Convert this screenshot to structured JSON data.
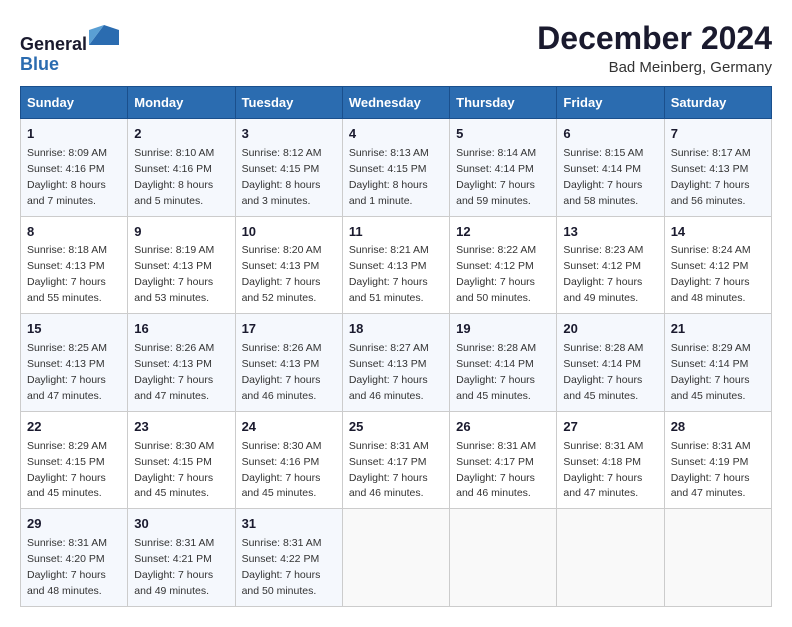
{
  "header": {
    "logo_line1": "General",
    "logo_line2": "Blue",
    "month": "December 2024",
    "location": "Bad Meinberg, Germany"
  },
  "days_of_week": [
    "Sunday",
    "Monday",
    "Tuesday",
    "Wednesday",
    "Thursday",
    "Friday",
    "Saturday"
  ],
  "weeks": [
    [
      {
        "day": "1",
        "sunrise": "8:09 AM",
        "sunset": "4:16 PM",
        "daylight": "8 hours and 7 minutes."
      },
      {
        "day": "2",
        "sunrise": "8:10 AM",
        "sunset": "4:16 PM",
        "daylight": "8 hours and 5 minutes."
      },
      {
        "day": "3",
        "sunrise": "8:12 AM",
        "sunset": "4:15 PM",
        "daylight": "8 hours and 3 minutes."
      },
      {
        "day": "4",
        "sunrise": "8:13 AM",
        "sunset": "4:15 PM",
        "daylight": "8 hours and 1 minute."
      },
      {
        "day": "5",
        "sunrise": "8:14 AM",
        "sunset": "4:14 PM",
        "daylight": "7 hours and 59 minutes."
      },
      {
        "day": "6",
        "sunrise": "8:15 AM",
        "sunset": "4:14 PM",
        "daylight": "7 hours and 58 minutes."
      },
      {
        "day": "7",
        "sunrise": "8:17 AM",
        "sunset": "4:13 PM",
        "daylight": "7 hours and 56 minutes."
      }
    ],
    [
      {
        "day": "8",
        "sunrise": "8:18 AM",
        "sunset": "4:13 PM",
        "daylight": "7 hours and 55 minutes."
      },
      {
        "day": "9",
        "sunrise": "8:19 AM",
        "sunset": "4:13 PM",
        "daylight": "7 hours and 53 minutes."
      },
      {
        "day": "10",
        "sunrise": "8:20 AM",
        "sunset": "4:13 PM",
        "daylight": "7 hours and 52 minutes."
      },
      {
        "day": "11",
        "sunrise": "8:21 AM",
        "sunset": "4:13 PM",
        "daylight": "7 hours and 51 minutes."
      },
      {
        "day": "12",
        "sunrise": "8:22 AM",
        "sunset": "4:12 PM",
        "daylight": "7 hours and 50 minutes."
      },
      {
        "day": "13",
        "sunrise": "8:23 AM",
        "sunset": "4:12 PM",
        "daylight": "7 hours and 49 minutes."
      },
      {
        "day": "14",
        "sunrise": "8:24 AM",
        "sunset": "4:12 PM",
        "daylight": "7 hours and 48 minutes."
      }
    ],
    [
      {
        "day": "15",
        "sunrise": "8:25 AM",
        "sunset": "4:13 PM",
        "daylight": "7 hours and 47 minutes."
      },
      {
        "day": "16",
        "sunrise": "8:26 AM",
        "sunset": "4:13 PM",
        "daylight": "7 hours and 47 minutes."
      },
      {
        "day": "17",
        "sunrise": "8:26 AM",
        "sunset": "4:13 PM",
        "daylight": "7 hours and 46 minutes."
      },
      {
        "day": "18",
        "sunrise": "8:27 AM",
        "sunset": "4:13 PM",
        "daylight": "7 hours and 46 minutes."
      },
      {
        "day": "19",
        "sunrise": "8:28 AM",
        "sunset": "4:14 PM",
        "daylight": "7 hours and 45 minutes."
      },
      {
        "day": "20",
        "sunrise": "8:28 AM",
        "sunset": "4:14 PM",
        "daylight": "7 hours and 45 minutes."
      },
      {
        "day": "21",
        "sunrise": "8:29 AM",
        "sunset": "4:14 PM",
        "daylight": "7 hours and 45 minutes."
      }
    ],
    [
      {
        "day": "22",
        "sunrise": "8:29 AM",
        "sunset": "4:15 PM",
        "daylight": "7 hours and 45 minutes."
      },
      {
        "day": "23",
        "sunrise": "8:30 AM",
        "sunset": "4:15 PM",
        "daylight": "7 hours and 45 minutes."
      },
      {
        "day": "24",
        "sunrise": "8:30 AM",
        "sunset": "4:16 PM",
        "daylight": "7 hours and 45 minutes."
      },
      {
        "day": "25",
        "sunrise": "8:31 AM",
        "sunset": "4:17 PM",
        "daylight": "7 hours and 46 minutes."
      },
      {
        "day": "26",
        "sunrise": "8:31 AM",
        "sunset": "4:17 PM",
        "daylight": "7 hours and 46 minutes."
      },
      {
        "day": "27",
        "sunrise": "8:31 AM",
        "sunset": "4:18 PM",
        "daylight": "7 hours and 47 minutes."
      },
      {
        "day": "28",
        "sunrise": "8:31 AM",
        "sunset": "4:19 PM",
        "daylight": "7 hours and 47 minutes."
      }
    ],
    [
      {
        "day": "29",
        "sunrise": "8:31 AM",
        "sunset": "4:20 PM",
        "daylight": "7 hours and 48 minutes."
      },
      {
        "day": "30",
        "sunrise": "8:31 AM",
        "sunset": "4:21 PM",
        "daylight": "7 hours and 49 minutes."
      },
      {
        "day": "31",
        "sunrise": "8:31 AM",
        "sunset": "4:22 PM",
        "daylight": "7 hours and 50 minutes."
      },
      null,
      null,
      null,
      null
    ]
  ]
}
